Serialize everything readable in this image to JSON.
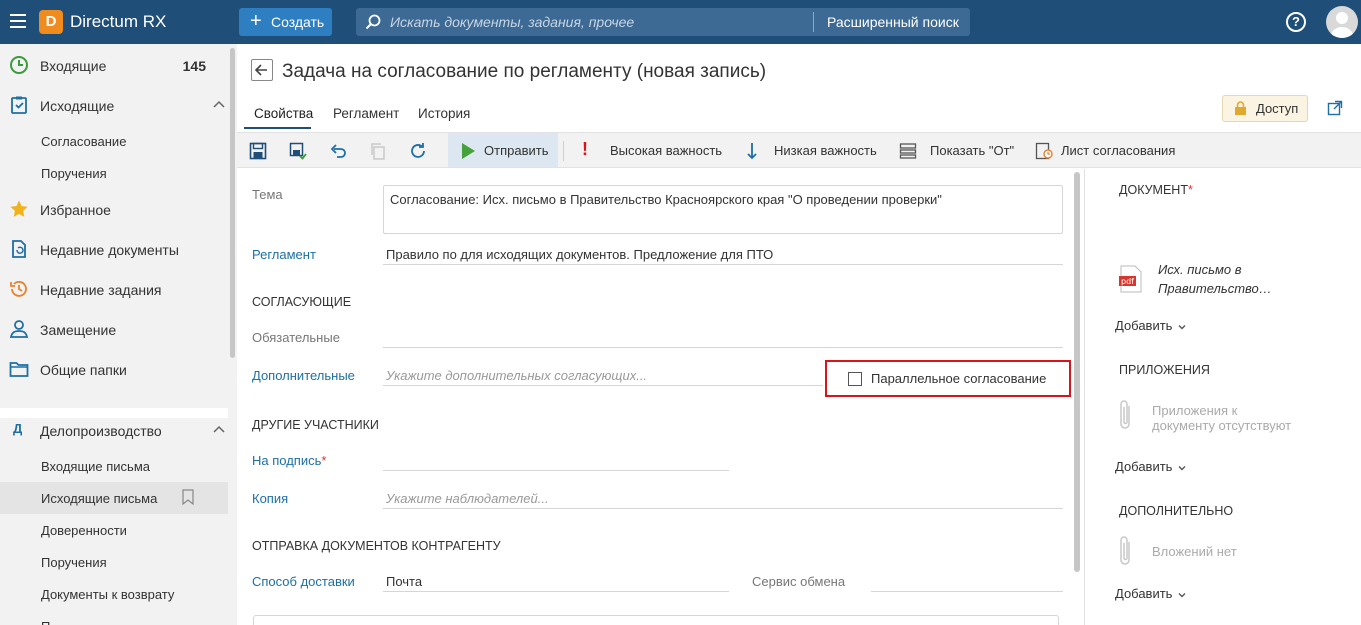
{
  "topbar": {
    "logo_letter": "D",
    "app_title": "Directum RX",
    "create_label": "Создать",
    "search_placeholder": "Искать документы, задания, прочее",
    "advanced_search_label": "Расширенный поиск",
    "help_label": "?"
  },
  "sidebar": {
    "inbox_label": "Входящие",
    "inbox_count": "145",
    "outbox_label": "Исходящие",
    "outbox_children": [
      "Согласование",
      "Поручения"
    ],
    "favorites_label": "Избранное",
    "recent_docs_label": "Недавние документы",
    "recent_tasks_label": "Недавние задания",
    "substitution_label": "Замещение",
    "shared_folders_label": "Общие папки",
    "records_icon_letter": "Д",
    "records_label": "Делопроизводство",
    "records_children": [
      "Входящие письма",
      "Исходящие письма",
      "Доверенности",
      "Поручения",
      "Документы к возврату",
      "П"
    ]
  },
  "header": {
    "title": "Задача на согласование по регламенту (новая запись)",
    "tabs": [
      "Свойства",
      "Регламент",
      "История"
    ],
    "access_label": "Доступ"
  },
  "toolbar": {
    "send_label": "Отправить",
    "high_importance_label": "Высокая важность",
    "low_importance_label": "Низкая важность",
    "show_from_label": "Показать \"От\"",
    "approval_sheet_label": "Лист согласования"
  },
  "form": {
    "subject_label": "Тема",
    "subject_value": "Согласование: Исх. письмо в Правительство Красноярского края \"О проведении проверки\"",
    "rule_label": "Регламент",
    "rule_value": "Правило по  для исходящих документов. Предложение для ПТО",
    "approvers_section": "СОГЛАСУЮЩИЕ",
    "required_label": "Обязательные",
    "additional_label": "Дополнительные",
    "additional_placeholder": "Укажите дополнительных согласующих...",
    "parallel_label": "Параллельное согласование",
    "others_section": "ДРУГИЕ УЧАСТНИКИ",
    "signatory_label": "На подпись",
    "required_mark": "*",
    "copy_label": "Копия",
    "copy_placeholder": "Укажите наблюдателей...",
    "sending_section": "ОТПРАВКА ДОКУМЕНТОВ КОНТРАГЕНТУ",
    "delivery_label": "Способ доставки",
    "delivery_value": "Почта",
    "exchange_label": "Сервис обмена"
  },
  "right_panel": {
    "document_title": "ДОКУМЕНТ",
    "required_mark": "*",
    "pdf_badge": "pdf",
    "document_name_line1": "Исх. письмо в",
    "document_name_line2": "Правительство…",
    "add_label": "Добавить",
    "attachments_title": "ПРИЛОЖЕНИЯ",
    "attachments_empty_line1": "Приложения к",
    "attachments_empty_line2": "документу отсутствуют",
    "additional_title": "ДОПОЛНИТЕЛЬНО",
    "additional_empty": "Вложений нет"
  },
  "colors": {
    "topbar": "#1f4e79",
    "create_button": "#2d7fc1",
    "link": "#1d6fa5",
    "highlight_border": "#d9141b",
    "logo": "#f08c1e"
  }
}
